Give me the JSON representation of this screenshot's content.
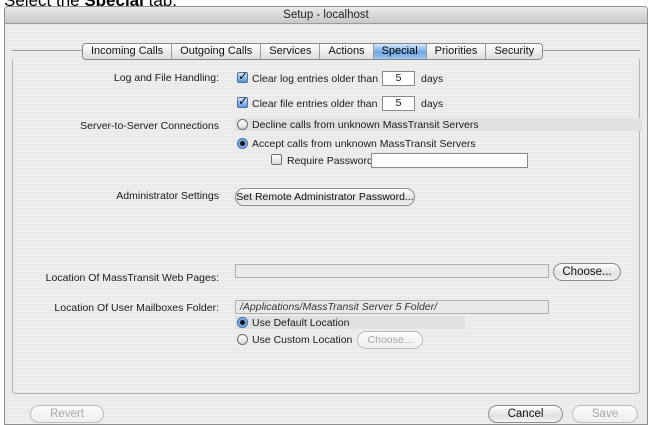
{
  "caption": {
    "prefix": "Select the ",
    "bold": "Special",
    "suffix": " tab."
  },
  "window": {
    "title": "Setup - localhost"
  },
  "tabs": [
    {
      "label": "Incoming Calls",
      "active": false
    },
    {
      "label": "Outgoing Calls",
      "active": false
    },
    {
      "label": "Services",
      "active": false
    },
    {
      "label": "Actions",
      "active": false
    },
    {
      "label": "Special",
      "active": true
    },
    {
      "label": "Priorities",
      "active": false
    },
    {
      "label": "Security",
      "active": false
    }
  ],
  "log": {
    "label": "Log and File Handling:",
    "clear_log": {
      "label": "Clear log entries older than",
      "checked": true,
      "value": "5",
      "unit": "days"
    },
    "clear_file": {
      "label": "Clear file entries older than",
      "checked": true,
      "value": "5",
      "unit": "days"
    }
  },
  "server": {
    "label": "Server-to-Server Connections",
    "decline": {
      "label": "Decline calls from unknown MassTransit Servers",
      "selected": false
    },
    "accept": {
      "label": "Accept calls from unknown MassTransit Servers",
      "selected": true
    },
    "require_password": {
      "label": "Require Password:",
      "checked": false,
      "value": ""
    }
  },
  "admin": {
    "label": "Administrator Settings",
    "button": "Set Remote Administrator Password..."
  },
  "web_pages": {
    "label": "Location Of MassTransit Web Pages:",
    "value": "",
    "button": "Choose..."
  },
  "mailboxes": {
    "label": "Location Of User Mailboxes Folder:",
    "path": "/Applications/MassTransit Server 5 Folder/",
    "default_option": {
      "label": "Use Default Location",
      "selected": true
    },
    "custom_option": {
      "label": "Use Custom Location",
      "selected": false
    },
    "button": "Choose..."
  },
  "footer": {
    "revert": "Revert",
    "cancel": "Cancel",
    "save": "Save"
  }
}
